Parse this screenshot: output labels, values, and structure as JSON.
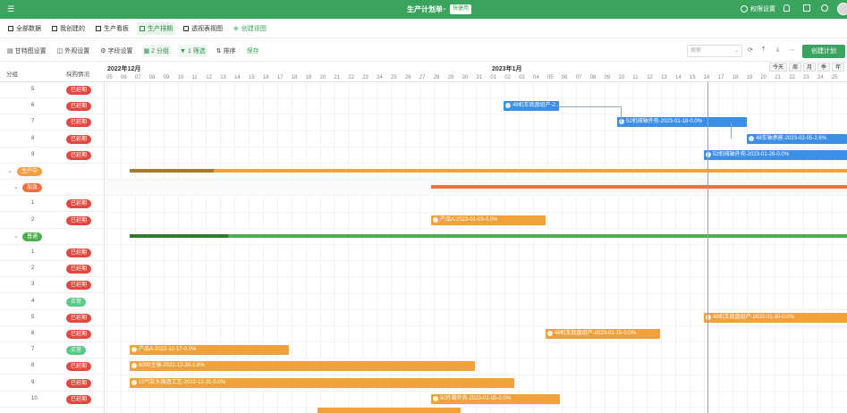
{
  "topbar": {
    "title": "生产计划单",
    "title_caret": "⌄",
    "badge": "快捷用",
    "right_link": "权限设置",
    "bg": "#3aa35d"
  },
  "views": [
    {
      "label": "全部数据",
      "active": false
    },
    {
      "label": "我创建的",
      "active": false
    },
    {
      "label": "生产看板",
      "active": false
    },
    {
      "label": "生产排期",
      "active": true
    },
    {
      "label": "透视表视图",
      "active": false
    },
    {
      "label": "创建视图",
      "active": false,
      "plus": true
    }
  ],
  "toolbar": {
    "gantt_settings": "甘特图设置",
    "appearance": "外观设置",
    "fields": "字段设置",
    "group": "2 分组",
    "filter": "1 筛选",
    "sort": "排序",
    "save": "保存",
    "search_placeholder": "搜索",
    "create": "创建计划"
  },
  "table_header": {
    "col1": "分组",
    "col2": "採购情况"
  },
  "scale": {
    "today": "今天",
    "week": "周",
    "month": "月",
    "quarter": "季",
    "year": "年"
  },
  "months": [
    "2022年12月",
    "2023年1月"
  ],
  "days": [
    "05",
    "06",
    "07",
    "08",
    "09",
    "10",
    "11",
    "12",
    "13",
    "14",
    "15",
    "16",
    "17",
    "18",
    "19",
    "20",
    "21",
    "22",
    "23",
    "24",
    "25",
    "26",
    "27",
    "28",
    "29",
    "30",
    "31",
    "01",
    "02",
    "03",
    "04",
    "05",
    "06",
    "07",
    "08",
    "09",
    "10",
    "11",
    "12",
    "13",
    "14",
    "15",
    "16",
    "17",
    "18",
    "19",
    "20",
    "21",
    "22",
    "23",
    "24",
    "25"
  ],
  "rows": [
    {
      "n": "5",
      "status": "已延期",
      "kind": "red"
    },
    {
      "n": "6",
      "status": "已延期",
      "kind": "red"
    },
    {
      "n": "7",
      "status": "已延期",
      "kind": "red"
    },
    {
      "n": "8",
      "status": "已延期",
      "kind": "red"
    },
    {
      "n": "9",
      "status": "已延期",
      "kind": "red"
    },
    {
      "group": "生产中",
      "color": "#f0a13c",
      "level": 0
    },
    {
      "group": "加急",
      "color": "#f07040",
      "level": 1
    },
    {
      "n": "1",
      "status": "已延期",
      "kind": "red"
    },
    {
      "n": "2",
      "status": "已延期",
      "kind": "red"
    },
    {
      "group": "普通",
      "color": "#4cae4c",
      "level": 1
    },
    {
      "n": "1",
      "status": "已延期",
      "kind": "red"
    },
    {
      "n": "2",
      "status": "已延期",
      "kind": "red"
    },
    {
      "n": "3",
      "status": "已延期",
      "kind": "red"
    },
    {
      "n": "4",
      "status": "正常",
      "kind": "green"
    },
    {
      "n": "5",
      "status": "已延期",
      "kind": "red"
    },
    {
      "n": "6",
      "status": "已延期",
      "kind": "red"
    },
    {
      "n": "7",
      "status": "正常",
      "kind": "green"
    },
    {
      "n": "8",
      "status": "已延期",
      "kind": "red"
    },
    {
      "n": "9",
      "status": "已延期",
      "kind": "red"
    },
    {
      "n": "10",
      "status": "已延期",
      "kind": "red"
    }
  ],
  "bars": [
    {
      "label": "48机车底盘组产-2...",
      "color": "blue",
      "row": 1
    },
    {
      "label": "52机械轴外壳-2023-01-18-0.0%",
      "color": "blue",
      "row": 2
    },
    {
      "label": "48车轴承座-2023-02-05-2.6%",
      "color": "blue",
      "row": 3
    },
    {
      "label": "52机械轴外壳-2023-01-26-0.0%",
      "color": "blue",
      "row": 4
    },
    {
      "label": "产品A-2023-01-03-0.0%",
      "color": "orange",
      "row": 8
    },
    {
      "label": "48机车底盘组产-2023-01-30-0.0%",
      "color": "orange",
      "row": 14
    },
    {
      "label": "48机车底盘组产-2023-01-15-0.0%",
      "color": "orange",
      "row": 15
    },
    {
      "label": "产品A-2022-12-17-0.0%",
      "color": "orange",
      "row": 16
    },
    {
      "label": "6000主轴-2022-12-30-1.8%",
      "color": "orange",
      "row": 17
    },
    {
      "label": "10气缸头铸造工艺-2022-12-31-0.0%",
      "color": "orange",
      "row": 18
    },
    {
      "label": "50外箱外壳-2023-01-05-0.0%",
      "color": "orange",
      "row": 19
    }
  ],
  "colors": {
    "accent": "#3aa35d",
    "blue": "#3b8fe6",
    "orange": "#f0a13c",
    "red": "#e0493f",
    "green": "#5cc98a"
  }
}
